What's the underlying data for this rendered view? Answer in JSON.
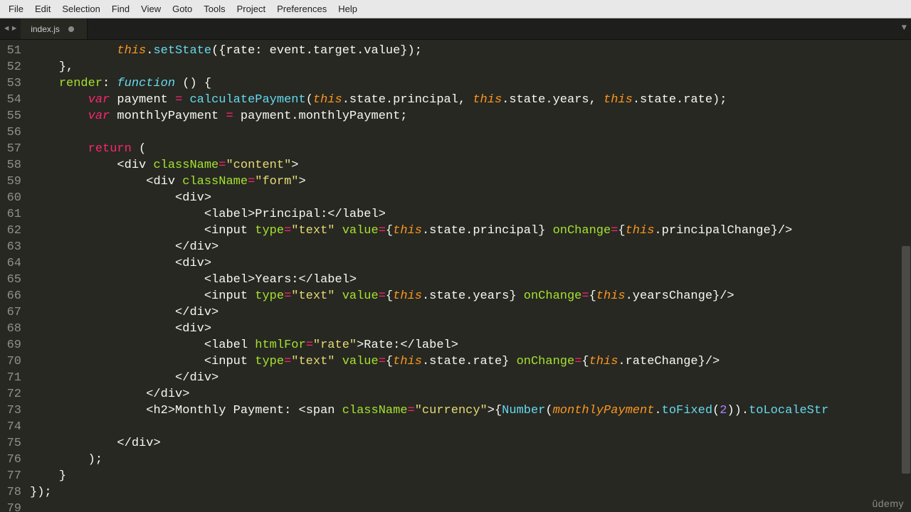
{
  "menubar": {
    "items": [
      "File",
      "Edit",
      "Selection",
      "Find",
      "View",
      "Goto",
      "Tools",
      "Project",
      "Preferences",
      "Help"
    ]
  },
  "tabs": {
    "nav_left": "◄",
    "nav_right": "►",
    "dropdown": "▼",
    "active": {
      "label": "index.js",
      "dirty": true
    }
  },
  "gutter": {
    "start": 51,
    "end": 79
  },
  "code": {
    "lines": [
      {
        "n": 51,
        "segs": [
          {
            "t": "            ",
            "c": "pln"
          },
          {
            "t": "this",
            "c": "this"
          },
          {
            "t": ".",
            "c": "pln"
          },
          {
            "t": "setState",
            "c": "call"
          },
          {
            "t": "({rate: event.target.value});",
            "c": "pln"
          }
        ]
      },
      {
        "n": 52,
        "segs": [
          {
            "t": "    },",
            "c": "pln"
          }
        ]
      },
      {
        "n": 53,
        "segs": [
          {
            "t": "    ",
            "c": "pln"
          },
          {
            "t": "render",
            "c": "name"
          },
          {
            "t": ": ",
            "c": "pln"
          },
          {
            "t": "function",
            "c": "fn"
          },
          {
            "t": " () {",
            "c": "pln"
          }
        ]
      },
      {
        "n": 54,
        "segs": [
          {
            "t": "        ",
            "c": "pln"
          },
          {
            "t": "var",
            "c": "kw"
          },
          {
            "t": " payment ",
            "c": "pln"
          },
          {
            "t": "=",
            "c": "op"
          },
          {
            "t": " ",
            "c": "pln"
          },
          {
            "t": "calculatePayment",
            "c": "call"
          },
          {
            "t": "(",
            "c": "pln"
          },
          {
            "t": "this",
            "c": "this"
          },
          {
            "t": ".state.principal, ",
            "c": "pln"
          },
          {
            "t": "this",
            "c": "this"
          },
          {
            "t": ".state.years, ",
            "c": "pln"
          },
          {
            "t": "this",
            "c": "this"
          },
          {
            "t": ".state.rate);",
            "c": "pln"
          }
        ]
      },
      {
        "n": 55,
        "segs": [
          {
            "t": "        ",
            "c": "pln"
          },
          {
            "t": "var",
            "c": "kw"
          },
          {
            "t": " monthlyPayment ",
            "c": "pln"
          },
          {
            "t": "=",
            "c": "op"
          },
          {
            "t": " payment.monthlyPayment;",
            "c": "pln"
          }
        ]
      },
      {
        "n": 56,
        "segs": [
          {
            "t": "",
            "c": "pln"
          }
        ]
      },
      {
        "n": 57,
        "segs": [
          {
            "t": "        ",
            "c": "pln"
          },
          {
            "t": "return",
            "c": "kw2"
          },
          {
            "t": " (",
            "c": "pln"
          }
        ]
      },
      {
        "n": 58,
        "segs": [
          {
            "t": "            <",
            "c": "pln"
          },
          {
            "t": "div ",
            "c": "tag"
          },
          {
            "t": "className",
            "c": "attr"
          },
          {
            "t": "=",
            "c": "op"
          },
          {
            "t": "\"content\"",
            "c": "str"
          },
          {
            "t": ">",
            "c": "pln"
          }
        ]
      },
      {
        "n": 59,
        "segs": [
          {
            "t": "                <",
            "c": "pln"
          },
          {
            "t": "div ",
            "c": "tag"
          },
          {
            "t": "className",
            "c": "attr"
          },
          {
            "t": "=",
            "c": "op"
          },
          {
            "t": "\"form\"",
            "c": "str"
          },
          {
            "t": ">",
            "c": "pln"
          }
        ]
      },
      {
        "n": 60,
        "segs": [
          {
            "t": "                    <",
            "c": "pln"
          },
          {
            "t": "div",
            "c": "tag"
          },
          {
            "t": ">",
            "c": "pln"
          }
        ]
      },
      {
        "n": 61,
        "segs": [
          {
            "t": "                        <",
            "c": "pln"
          },
          {
            "t": "label",
            "c": "tag"
          },
          {
            "t": ">Principal:</",
            "c": "pln"
          },
          {
            "t": "label",
            "c": "tag"
          },
          {
            "t": ">",
            "c": "pln"
          }
        ]
      },
      {
        "n": 62,
        "segs": [
          {
            "t": "                        <",
            "c": "pln"
          },
          {
            "t": "input ",
            "c": "tag"
          },
          {
            "t": "type",
            "c": "attr"
          },
          {
            "t": "=",
            "c": "op"
          },
          {
            "t": "\"text\"",
            "c": "str"
          },
          {
            "t": " ",
            "c": "pln"
          },
          {
            "t": "value",
            "c": "attr"
          },
          {
            "t": "=",
            "c": "op"
          },
          {
            "t": "{",
            "c": "pln"
          },
          {
            "t": "this",
            "c": "this"
          },
          {
            "t": ".state.principal} ",
            "c": "pln"
          },
          {
            "t": "onChange",
            "c": "attr"
          },
          {
            "t": "=",
            "c": "op"
          },
          {
            "t": "{",
            "c": "pln"
          },
          {
            "t": "this",
            "c": "this"
          },
          {
            "t": ".principalChange}/>",
            "c": "pln"
          }
        ]
      },
      {
        "n": 63,
        "segs": [
          {
            "t": "                    </",
            "c": "pln"
          },
          {
            "t": "div",
            "c": "tag"
          },
          {
            "t": ">",
            "c": "pln"
          }
        ]
      },
      {
        "n": 64,
        "segs": [
          {
            "t": "                    <",
            "c": "pln"
          },
          {
            "t": "div",
            "c": "tag"
          },
          {
            "t": ">",
            "c": "pln"
          }
        ]
      },
      {
        "n": 65,
        "segs": [
          {
            "t": "                        <",
            "c": "pln"
          },
          {
            "t": "label",
            "c": "tag"
          },
          {
            "t": ">Years:</",
            "c": "pln"
          },
          {
            "t": "label",
            "c": "tag"
          },
          {
            "t": ">",
            "c": "pln"
          }
        ]
      },
      {
        "n": 66,
        "segs": [
          {
            "t": "                        <",
            "c": "pln"
          },
          {
            "t": "input ",
            "c": "tag"
          },
          {
            "t": "type",
            "c": "attr"
          },
          {
            "t": "=",
            "c": "op"
          },
          {
            "t": "\"text\"",
            "c": "str"
          },
          {
            "t": " ",
            "c": "pln"
          },
          {
            "t": "value",
            "c": "attr"
          },
          {
            "t": "=",
            "c": "op"
          },
          {
            "t": "{",
            "c": "pln"
          },
          {
            "t": "this",
            "c": "this"
          },
          {
            "t": ".state.years} ",
            "c": "pln"
          },
          {
            "t": "onChange",
            "c": "attr"
          },
          {
            "t": "=",
            "c": "op"
          },
          {
            "t": "{",
            "c": "pln"
          },
          {
            "t": "this",
            "c": "this"
          },
          {
            "t": ".yearsChange}/>",
            "c": "pln"
          }
        ]
      },
      {
        "n": 67,
        "segs": [
          {
            "t": "                    </",
            "c": "pln"
          },
          {
            "t": "div",
            "c": "tag"
          },
          {
            "t": ">",
            "c": "pln"
          }
        ]
      },
      {
        "n": 68,
        "segs": [
          {
            "t": "                    <",
            "c": "pln"
          },
          {
            "t": "div",
            "c": "tag"
          },
          {
            "t": ">",
            "c": "pln"
          }
        ]
      },
      {
        "n": 69,
        "segs": [
          {
            "t": "                        <",
            "c": "pln"
          },
          {
            "t": "label ",
            "c": "tag"
          },
          {
            "t": "htmlFor",
            "c": "attr"
          },
          {
            "t": "=",
            "c": "op"
          },
          {
            "t": "\"rate\"",
            "c": "str"
          },
          {
            "t": ">Rate:</",
            "c": "pln"
          },
          {
            "t": "label",
            "c": "tag"
          },
          {
            "t": ">",
            "c": "pln"
          }
        ]
      },
      {
        "n": 70,
        "segs": [
          {
            "t": "                        <",
            "c": "pln"
          },
          {
            "t": "input ",
            "c": "tag"
          },
          {
            "t": "type",
            "c": "attr"
          },
          {
            "t": "=",
            "c": "op"
          },
          {
            "t": "\"text\"",
            "c": "str"
          },
          {
            "t": " ",
            "c": "pln"
          },
          {
            "t": "value",
            "c": "attr"
          },
          {
            "t": "=",
            "c": "op"
          },
          {
            "t": "{",
            "c": "pln"
          },
          {
            "t": "this",
            "c": "this"
          },
          {
            "t": ".state.rate} ",
            "c": "pln"
          },
          {
            "t": "onChange",
            "c": "attr"
          },
          {
            "t": "=",
            "c": "op"
          },
          {
            "t": "{",
            "c": "pln"
          },
          {
            "t": "this",
            "c": "this"
          },
          {
            "t": ".rateChange}/>",
            "c": "pln"
          }
        ]
      },
      {
        "n": 71,
        "segs": [
          {
            "t": "                    </",
            "c": "pln"
          },
          {
            "t": "div",
            "c": "tag"
          },
          {
            "t": ">",
            "c": "pln"
          }
        ]
      },
      {
        "n": 72,
        "segs": [
          {
            "t": "                </",
            "c": "pln"
          },
          {
            "t": "div",
            "c": "tag"
          },
          {
            "t": ">",
            "c": "pln"
          }
        ]
      },
      {
        "n": 73,
        "segs": [
          {
            "t": "                <",
            "c": "pln"
          },
          {
            "t": "h2",
            "c": "tag"
          },
          {
            "t": ">Monthly Payment: <",
            "c": "pln"
          },
          {
            "t": "span ",
            "c": "tag"
          },
          {
            "t": "className",
            "c": "attr"
          },
          {
            "t": "=",
            "c": "op"
          },
          {
            "t": "\"currency\"",
            "c": "str"
          },
          {
            "t": ">{",
            "c": "pln"
          },
          {
            "t": "Number",
            "c": "call"
          },
          {
            "t": "(",
            "c": "pln"
          },
          {
            "t": "monthlyPayment",
            "c": "this"
          },
          {
            "t": ".",
            "c": "pln"
          },
          {
            "t": "toFixed",
            "c": "call"
          },
          {
            "t": "(",
            "c": "pln"
          },
          {
            "t": "2",
            "c": "num"
          },
          {
            "t": ")).",
            "c": "pln"
          },
          {
            "t": "toLocaleStr",
            "c": "call"
          }
        ]
      },
      {
        "n": 74,
        "segs": [
          {
            "t": "",
            "c": "pln"
          }
        ]
      },
      {
        "n": 75,
        "segs": [
          {
            "t": "            </",
            "c": "pln"
          },
          {
            "t": "div",
            "c": "tag"
          },
          {
            "t": ">",
            "c": "pln"
          }
        ]
      },
      {
        "n": 76,
        "segs": [
          {
            "t": "        );",
            "c": "pln"
          }
        ]
      },
      {
        "n": 77,
        "segs": [
          {
            "t": "    }",
            "c": "pln"
          }
        ]
      },
      {
        "n": 78,
        "segs": [
          {
            "t": "});",
            "c": "pln"
          }
        ]
      },
      {
        "n": 79,
        "segs": [
          {
            "t": "",
            "c": "pln"
          }
        ]
      }
    ]
  },
  "watermark": "ûdemy"
}
